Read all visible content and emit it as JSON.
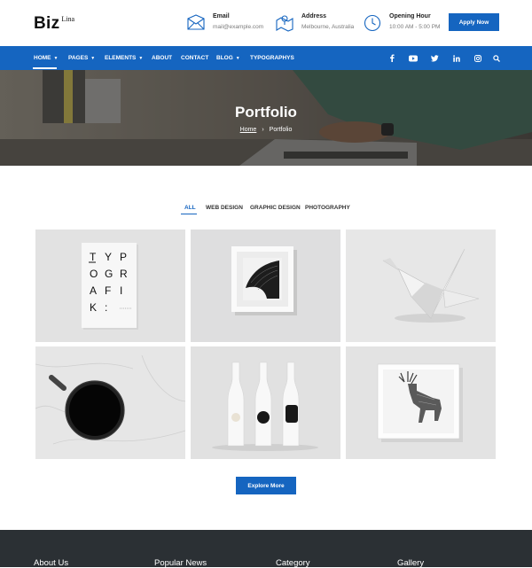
{
  "logo": {
    "main": "Biz",
    "sup": "Lina"
  },
  "header": {
    "email": {
      "title": "Email",
      "value": "mail@example.com"
    },
    "address": {
      "title": "Address",
      "value": "Melbourne, Australia"
    },
    "hours": {
      "title": "Opening Hour",
      "value": "10:00 AM - 5:00 PM"
    },
    "apply_label": "Apply Now"
  },
  "nav": {
    "items": [
      {
        "label": "HOME",
        "caret": "▼"
      },
      {
        "label": "PAGES",
        "caret": "▼"
      },
      {
        "label": "ELEMENTS",
        "caret": "▼"
      },
      {
        "label": "ABOUT"
      },
      {
        "label": "CONTACT"
      },
      {
        "label": "BLOG",
        "caret": "▼"
      },
      {
        "label": "TYPOGRAPHYS"
      }
    ],
    "social": [
      "facebook-icon",
      "youtube-icon",
      "twitter-icon",
      "linkedin-icon",
      "instagram-icon",
      "search-icon"
    ]
  },
  "banner": {
    "title": "Portfolio",
    "breadcrumb": {
      "home": "Home",
      "sep": "›",
      "current": "Portfolio"
    }
  },
  "filters": [
    "ALL",
    "WEB DESIGN",
    "GRAPHIC DESIGN",
    "PHOTOGRAPHY"
  ],
  "portfolio": {
    "typography_book": [
      "T",
      "Y",
      "P",
      "O",
      "G",
      "R",
      "A",
      "F",
      "I",
      "K",
      ":"
    ],
    "explore_label": "Explore More"
  },
  "footer": {
    "headings": [
      "About Us",
      "Popular News",
      "Category",
      "Gallery"
    ]
  },
  "colors": {
    "brand": "#1565c0",
    "footer": "#2b3034"
  }
}
